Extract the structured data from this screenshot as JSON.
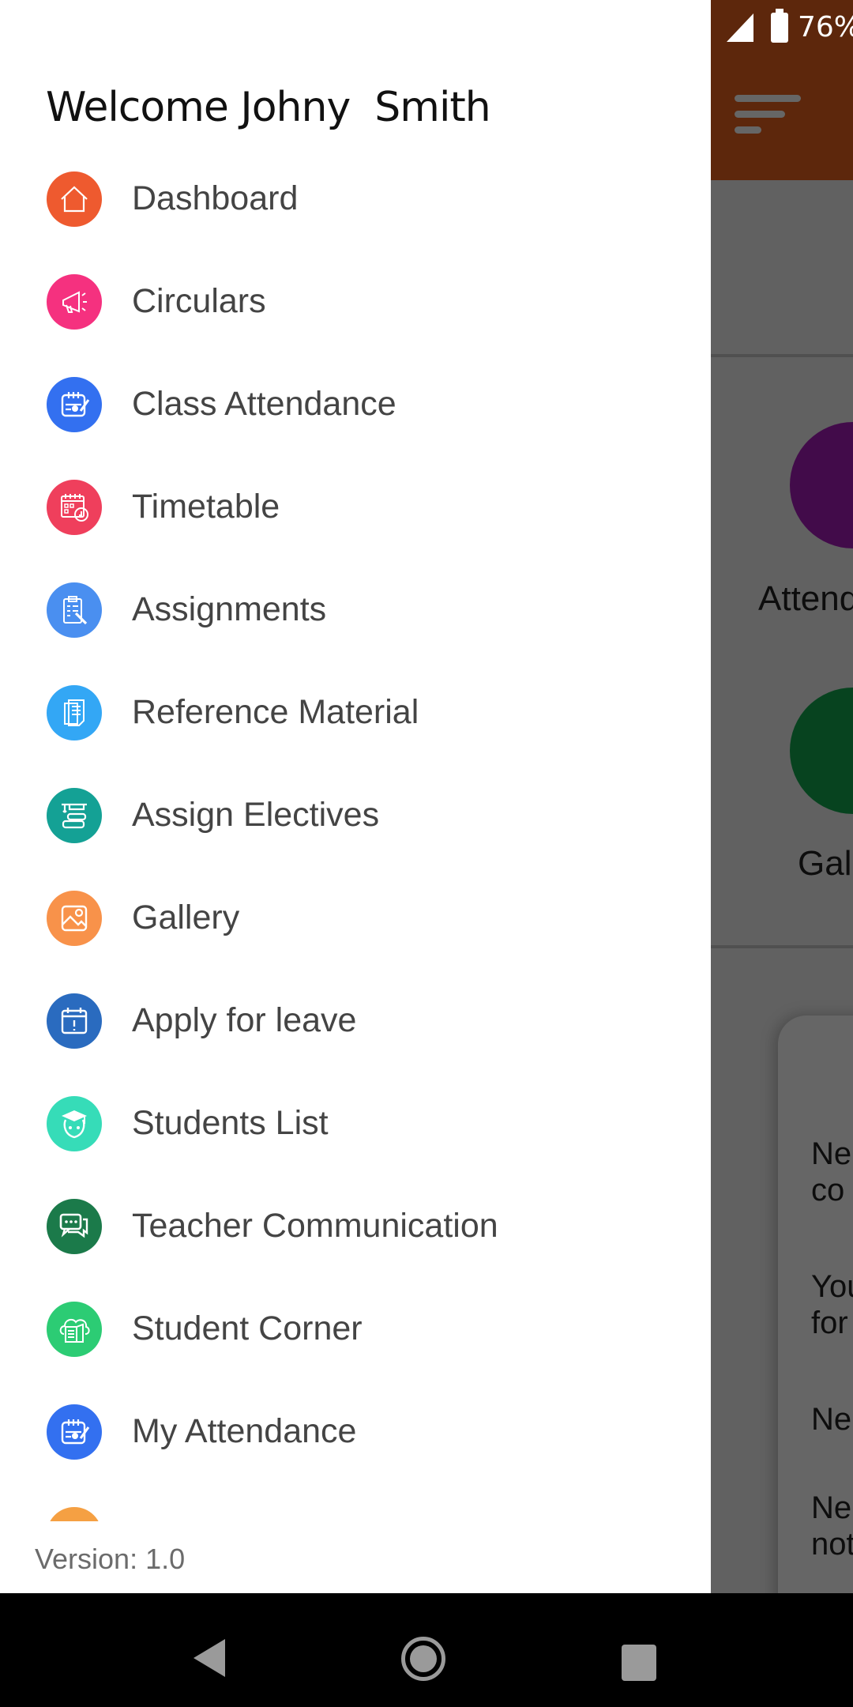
{
  "status_bar": {
    "battery": "76%"
  },
  "background_screen": {
    "tiles": [
      {
        "label": "Attendance",
        "color": "#a61cb8"
      },
      {
        "label": "Gallery",
        "color": "#12a94e"
      }
    ],
    "notices": [
      "Ne\nco",
      "You\nfor",
      "Ne",
      "Ne\nnot"
    ],
    "header_color": "#e8621f"
  },
  "drawer": {
    "welcome": "Welcome Johny  Smith",
    "items": [
      {
        "label": "Dashboard",
        "icon": "home-icon",
        "color": "#ee5a2f"
      },
      {
        "label": "Circulars",
        "icon": "megaphone-icon",
        "color": "#f5317f"
      },
      {
        "label": "Class Attendance",
        "icon": "attendance-icon",
        "color": "#3370f0"
      },
      {
        "label": "Timetable",
        "icon": "timetable-icon",
        "color": "#ef3f5c"
      },
      {
        "label": "Assignments",
        "icon": "clipboard-icon",
        "color": "#4a8ff0"
      },
      {
        "label": "Reference Material",
        "icon": "documents-icon",
        "color": "#33a7f5"
      },
      {
        "label": "Assign Electives",
        "icon": "books-icon",
        "color": "#14a195"
      },
      {
        "label": "Gallery",
        "icon": "image-icon",
        "color": "#f8924a"
      },
      {
        "label": "Apply for leave",
        "icon": "calendar-alert-icon",
        "color": "#2a6bbf"
      },
      {
        "label": "Students List",
        "icon": "student-icon",
        "color": "#36dcb8"
      },
      {
        "label": "Teacher Communication",
        "icon": "chat-icon",
        "color": "#1b7a4a"
      },
      {
        "label": "Student Corner",
        "icon": "cloud-book-icon",
        "color": "#2ccc74"
      },
      {
        "label": "My Attendance",
        "icon": "attendance-icon",
        "color": "#3370f0"
      },
      {
        "label": "",
        "icon": "bell-icon",
        "color": "#f5a043"
      }
    ],
    "version": "Version: 1.0"
  }
}
